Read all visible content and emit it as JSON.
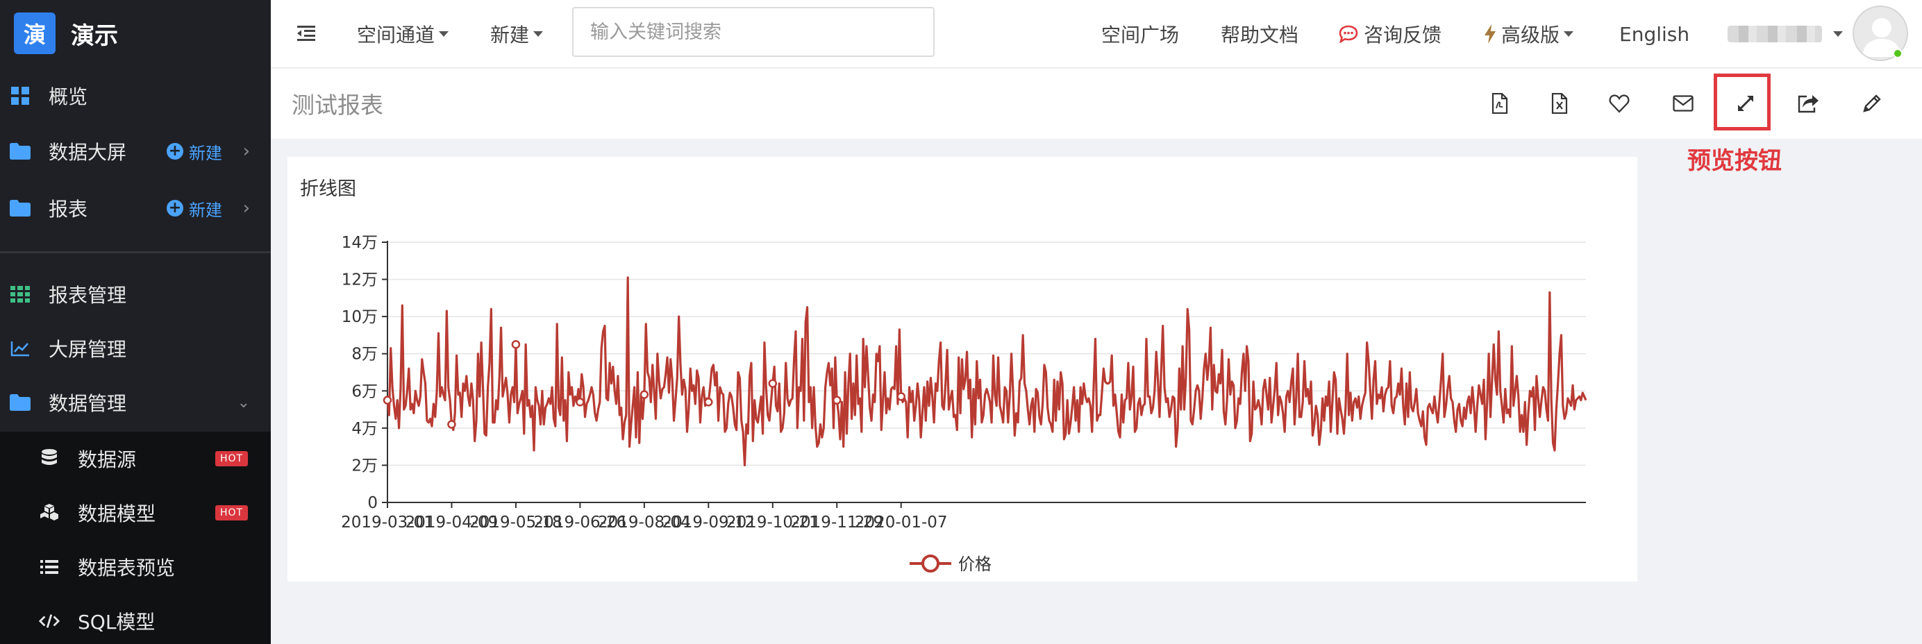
{
  "app": {
    "logo_char": "演",
    "name": "演示"
  },
  "sidebar": {
    "overview": "概览",
    "bigscreen": "数据大屏",
    "report": "报表",
    "new_label": "新建",
    "report_mgmt": "报表管理",
    "screen_mgmt": "大屏管理",
    "data_mgmt": "数据管理",
    "sub_items": [
      {
        "label": "数据源",
        "badge": "HOT"
      },
      {
        "label": "数据模型",
        "badge": "HOT"
      },
      {
        "label": "数据表预览"
      },
      {
        "label": "SQL模型"
      }
    ]
  },
  "topbar": {
    "space_channel": "空间通道",
    "new": "新建",
    "search_placeholder": "输入关键词搜索",
    "space_square": "空间广场",
    "help_docs": "帮助文档",
    "feedback": "咨询反馈",
    "premium": "高级版",
    "language": "English"
  },
  "report": {
    "title": "测试报表",
    "toolbar_icons": [
      "export-pdf-icon",
      "export-excel-icon",
      "favorite-icon",
      "email-icon",
      "fullscreen-preview-icon",
      "share-icon",
      "edit-icon"
    ],
    "highlight_label": "预览按钮"
  },
  "colors": {
    "series": "#b83b32",
    "accent": "#2f80ed",
    "highlight": "#e0393e",
    "sidebar_bg": "#1f2026"
  },
  "chart_data": {
    "type": "line",
    "title": "折线图",
    "legend": [
      "价格"
    ],
    "legend_position": "bottom",
    "grid": true,
    "ylim": [
      0,
      140000
    ],
    "y_ticks": [
      "0",
      "2万",
      "4万",
      "6万",
      "8万",
      "10万",
      "12万",
      "14万"
    ],
    "x_ticks": [
      "2019-03-01",
      "2019-04-09",
      "2019-05-18",
      "2019-06-26",
      "2019-08-04",
      "2019-09-12",
      "2019-10-21",
      "2019-11-29",
      "2020-01-07"
    ],
    "x_start": "2019-03-01",
    "x_step_days": 1,
    "series": [
      {
        "name": "价格",
        "values": [
          55000,
          47000,
          83000,
          62000,
          52000,
          45000,
          55000,
          40000,
          62000,
          106000,
          50000,
          52000,
          60000,
          72000,
          50000,
          53000,
          48000,
          60000,
          55000,
          52000,
          57000,
          77000,
          70000,
          64000,
          44000,
          43000,
          45000,
          41000,
          53000,
          46000,
          60000,
          91000,
          57000,
          62000,
          58000,
          55000,
          103000,
          62000,
          55000,
          42000,
          39000,
          48000,
          79000,
          58000,
          59000,
          46000,
          64000,
          60000,
          68000,
          57000,
          52000,
          64000,
          55000,
          33000,
          44000,
          80000,
          57000,
          86000,
          62000,
          37000,
          36000,
          62000,
          75000,
          104000,
          43000,
          43000,
          55000,
          50000,
          67000,
          94000,
          57000,
          62000,
          67000,
          58000,
          43000,
          58000,
          62000,
          54000,
          85000,
          48000,
          53000,
          56000,
          60000,
          37000,
          85000,
          52000,
          55000,
          46000,
          52000,
          28000,
          62000,
          55000,
          52000,
          42000,
          60000,
          42000,
          51000,
          53000,
          56000,
          53000,
          62000,
          45000,
          41000,
          96000,
          51000,
          47000,
          78000,
          44000,
          55000,
          33000,
          70000,
          58000,
          62000,
          52000,
          57000,
          54000,
          61000,
          54000,
          69000,
          62000,
          46000,
          53000,
          55000,
          58000,
          62000,
          58000,
          48000,
          44000,
          50000,
          54000,
          83000,
          92000,
          95000,
          56000,
          55000,
          75000,
          64000,
          73000,
          60000,
          53000,
          68000,
          47000,
          51000,
          34000,
          43000,
          47000,
          121000,
          30000,
          42000,
          52000,
          62000,
          35000,
          70000,
          32000,
          58000,
          45000,
          58000,
          96000,
          70000,
          67000,
          54000,
          74000,
          60000,
          45000,
          80000,
          65000,
          56000,
          61000,
          62000,
          69000,
          78000,
          59000,
          77000,
          66000,
          44000,
          55000,
          67000,
          100000,
          74000,
          58000,
          66000,
          61000,
          38000,
          50000,
          72000,
          60000,
          63000,
          53000,
          71000,
          67000,
          43000,
          57000,
          62000,
          52000,
          56000,
          54000,
          62000,
          72000,
          74000,
          63000,
          70000,
          44000,
          62000,
          59000,
          58000,
          38000,
          40000,
          53000,
          59000,
          57000,
          51000,
          42000,
          39000,
          70000,
          67000,
          44000,
          38000,
          20000,
          42000,
          37000,
          68000,
          75000,
          33000,
          55000,
          45000,
          43000,
          50000,
          57000,
          37000,
          86000,
          62000,
          47000,
          44000,
          54000,
          64000,
          73000,
          52000,
          49000,
          64000,
          38000,
          40000,
          48000,
          75000,
          56000,
          52000,
          55000,
          56000,
          77000,
          92000,
          40000,
          62000,
          60000,
          88000,
          44000,
          97000,
          105000,
          54000,
          62000,
          40000,
          62000,
          41000,
          30000,
          32000,
          42000,
          35000,
          40000,
          62000,
          70000,
          75000,
          63000,
          72000,
          40000,
          78000,
          55000,
          48000,
          34000,
          54000,
          30000,
          70000,
          37000,
          64000,
          80000,
          45000,
          64000,
          47000,
          79000,
          53000,
          56000,
          38000,
          88000,
          62000,
          84000,
          68000,
          51000,
          44000,
          58000,
          54000,
          80000,
          76000,
          84000,
          39000,
          55000,
          70000,
          48000,
          56000,
          50000,
          61000,
          62000,
          61000,
          84000,
          53000,
          93000,
          57000,
          54000,
          56000,
          54000,
          35000,
          62000,
          54000,
          60000,
          44000,
          52000,
          64000,
          55000,
          35000,
          49000,
          62000,
          44000,
          65000,
          52000,
          67000,
          57000,
          43000,
          64000,
          60000,
          76000,
          86000,
          52000,
          50000,
          64000,
          82000,
          50000,
          56000,
          60000,
          46000,
          47000,
          39000,
          78000,
          48000,
          77000,
          61000,
          66000,
          81000,
          56000,
          66000,
          35000,
          61000,
          42000,
          76000,
          56000,
          66000,
          43000,
          47000,
          58000,
          61000,
          58000,
          54000,
          43000,
          79000,
          58000,
          52000,
          78000,
          52000,
          48000,
          43000,
          62000,
          60000,
          43000,
          57000,
          80000,
          60000,
          36000,
          48000,
          43000,
          65000,
          67000,
          90000,
          64000,
          60000,
          50000,
          42000,
          52000,
          56000,
          38000,
          61000,
          59000,
          46000,
          42000,
          53000,
          74000,
          70000,
          51000,
          44000,
          42000,
          38000,
          66000,
          44000,
          65000,
          50000,
          70000,
          64000,
          34000,
          37000,
          55000,
          37000,
          43000,
          52000,
          62000,
          44000,
          55000,
          38000,
          62000,
          53000,
          64000,
          57000,
          54000,
          56000,
          52000,
          38000,
          63000,
          88000,
          44000,
          47000,
          47000,
          59000,
          72000,
          65000,
          64000,
          64000,
          65000,
          79000,
          52000,
          58000,
          48000,
          38000,
          35000,
          58000,
          43000,
          55000,
          56000,
          75000,
          50000,
          57000,
          73000,
          38000,
          40000,
          53000,
          56000,
          47000,
          52000,
          53000,
          88000,
          57000,
          57000,
          48000,
          51000,
          60000,
          81000,
          66000,
          46000,
          71000,
          95000,
          62000,
          54000,
          56000,
          46000,
          50000,
          57000,
          56000,
          30000,
          40000,
          72000,
          50000,
          84000,
          50000,
          67000,
          104000,
          93000,
          44000,
          42000,
          50000,
          60000,
          63000,
          60000,
          45000,
          56000,
          72000,
          80000,
          66000,
          75000,
          94000,
          50000,
          74000,
          60000,
          59000,
          69000,
          64000,
          82000,
          49000,
          42000,
          55000,
          77000,
          58000,
          65000,
          63000,
          40000,
          44000,
          56000,
          53000,
          70000,
          80000,
          60000,
          84000,
          76000,
          33000,
          37000,
          65000,
          50000,
          51000,
          55000,
          51000,
          42000,
          61000,
          66000,
          58000,
          50000,
          67000,
          43000,
          52000,
          61000,
          75000,
          47000,
          57000,
          54000,
          48000,
          38000,
          57000,
          60000,
          54000,
          65000,
          72000,
          42000,
          56000,
          80000,
          46000,
          46000,
          54000,
          76000,
          57000,
          61000,
          53000,
          65000,
          36000,
          42000,
          52000,
          47000,
          31000,
          39000,
          56000,
          44000,
          57000,
          52000,
          65000,
          38000,
          54000,
          70000,
          66000,
          37000,
          56000,
          50000,
          45000,
          37000,
          51000,
          80000,
          47000,
          59000,
          44000,
          54000,
          56000,
          51000,
          57000,
          45000,
          52000,
          56000,
          59000,
          86000,
          76000,
          60000,
          45000,
          66000,
          76000,
          53000,
          58000,
          56000,
          62000,
          49000,
          58000,
          61000,
          62000,
          76000,
          52000,
          48000,
          56000,
          57000,
          64000,
          58000,
          72000,
          52000,
          42000,
          64000,
          46000,
          70000,
          51000,
          49000,
          54000,
          61000,
          48000,
          44000,
          41000,
          49000,
          35000,
          31000,
          51000,
          53000,
          50000,
          48000,
          57000,
          49000,
          43000,
          54000,
          66000,
          80000,
          46000,
          52000,
          61000,
          68000,
          56000,
          54000,
          44000,
          38000,
          50000,
          53000,
          44000,
          41000,
          51000,
          45000,
          54000,
          57000,
          48000,
          62000,
          52000,
          38000,
          52000,
          63000,
          58000,
          53000,
          66000,
          34000,
          54000,
          80000,
          46000,
          66000,
          85000,
          66000,
          58000,
          92000,
          60000,
          52000,
          43000,
          61000,
          48000,
          50000,
          46000,
          84000,
          52000,
          60000,
          68000,
          57000,
          38000,
          47000,
          38000,
          54000,
          31000,
          48000,
          60000,
          57000,
          62000,
          39000,
          68000,
          56000,
          46000,
          55000,
          62000,
          60000,
          50000,
          44000,
          113000,
          55000,
          32000,
          28000,
          50000,
          64000,
          80000,
          90000,
          52000,
          45000,
          48000,
          56000,
          54000,
          52000,
          63000,
          50000,
          55000,
          56000,
          57000,
          55000,
          59000,
          57000,
          55000
        ]
      }
    ],
    "markers_on": [
      "2019-03-01",
      "2019-04-09",
      "2019-05-18",
      "2019-06-26",
      "2019-08-04",
      "2019-09-12",
      "2019-10-21",
      "2019-11-29",
      "2020-01-07"
    ]
  }
}
